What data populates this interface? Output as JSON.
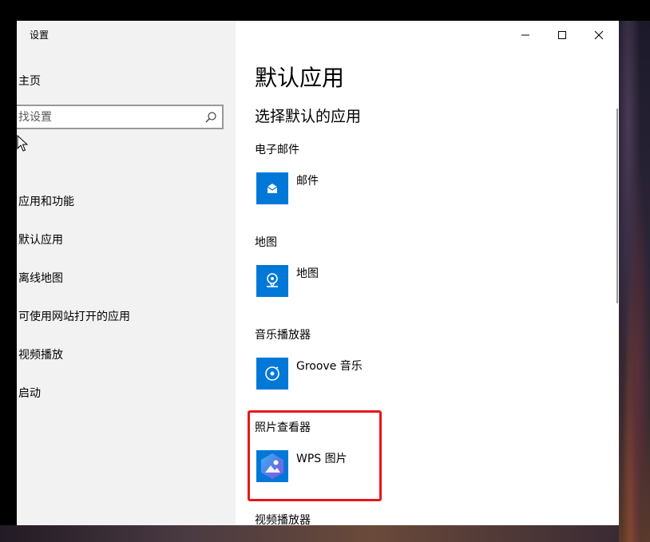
{
  "window": {
    "title": "设置",
    "controls": [
      "minimize",
      "maximize",
      "close"
    ]
  },
  "sidebar": {
    "home_label": "主页",
    "search": {
      "placeholder": "找设置"
    },
    "items": [
      {
        "label": "应用和功能"
      },
      {
        "label": "默认应用"
      },
      {
        "label": "离线地图"
      },
      {
        "label": "可使用网站打开的应用"
      },
      {
        "label": "视频播放"
      },
      {
        "label": "启动"
      }
    ]
  },
  "main": {
    "title": "默认应用",
    "subtitle": "选择默认的应用",
    "categories": [
      {
        "label": "电子邮件",
        "app": "邮件",
        "icon": "mail-icon"
      },
      {
        "label": "地图",
        "app": "地图",
        "icon": "maps-icon"
      },
      {
        "label": "音乐播放器",
        "app": "Groove 音乐",
        "icon": "groove-music-icon"
      },
      {
        "label": "照片查看器",
        "app": "WPS 图片",
        "icon": "wps-pictures-icon"
      },
      {
        "label": "视频播放器"
      }
    ]
  },
  "colors": {
    "accent": "#0078d7",
    "highlight_border": "#e8161c",
    "sidebar_bg": "#f2f2f2"
  }
}
